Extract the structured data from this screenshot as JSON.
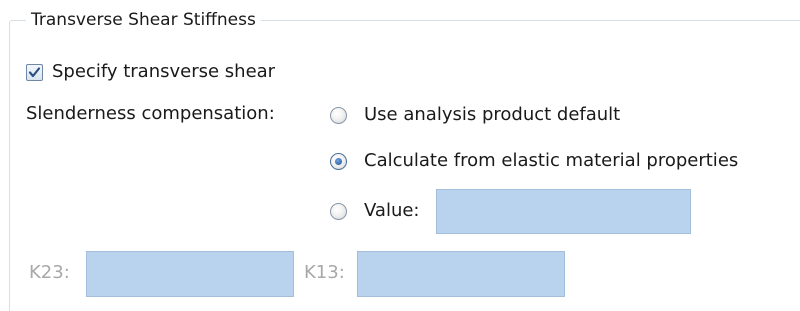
{
  "group": {
    "title": "Transverse Shear Stiffness"
  },
  "specify_shear": {
    "label": "Specify transverse shear",
    "checked": true
  },
  "slenderness": {
    "label": "Slenderness compensation:",
    "options": [
      {
        "label": "Use analysis product default",
        "selected": false
      },
      {
        "label": "Calculate from elastic material properties",
        "selected": true
      },
      {
        "label": "Value:",
        "selected": false
      }
    ],
    "value": ""
  },
  "k23": {
    "label": "K23:",
    "value": ""
  },
  "k13": {
    "label": "K13:",
    "value": ""
  },
  "colors": {
    "field_fill": "#b9d3ee",
    "disabled_text": "#a8a8a8",
    "group_border": "#d5dfe5"
  }
}
